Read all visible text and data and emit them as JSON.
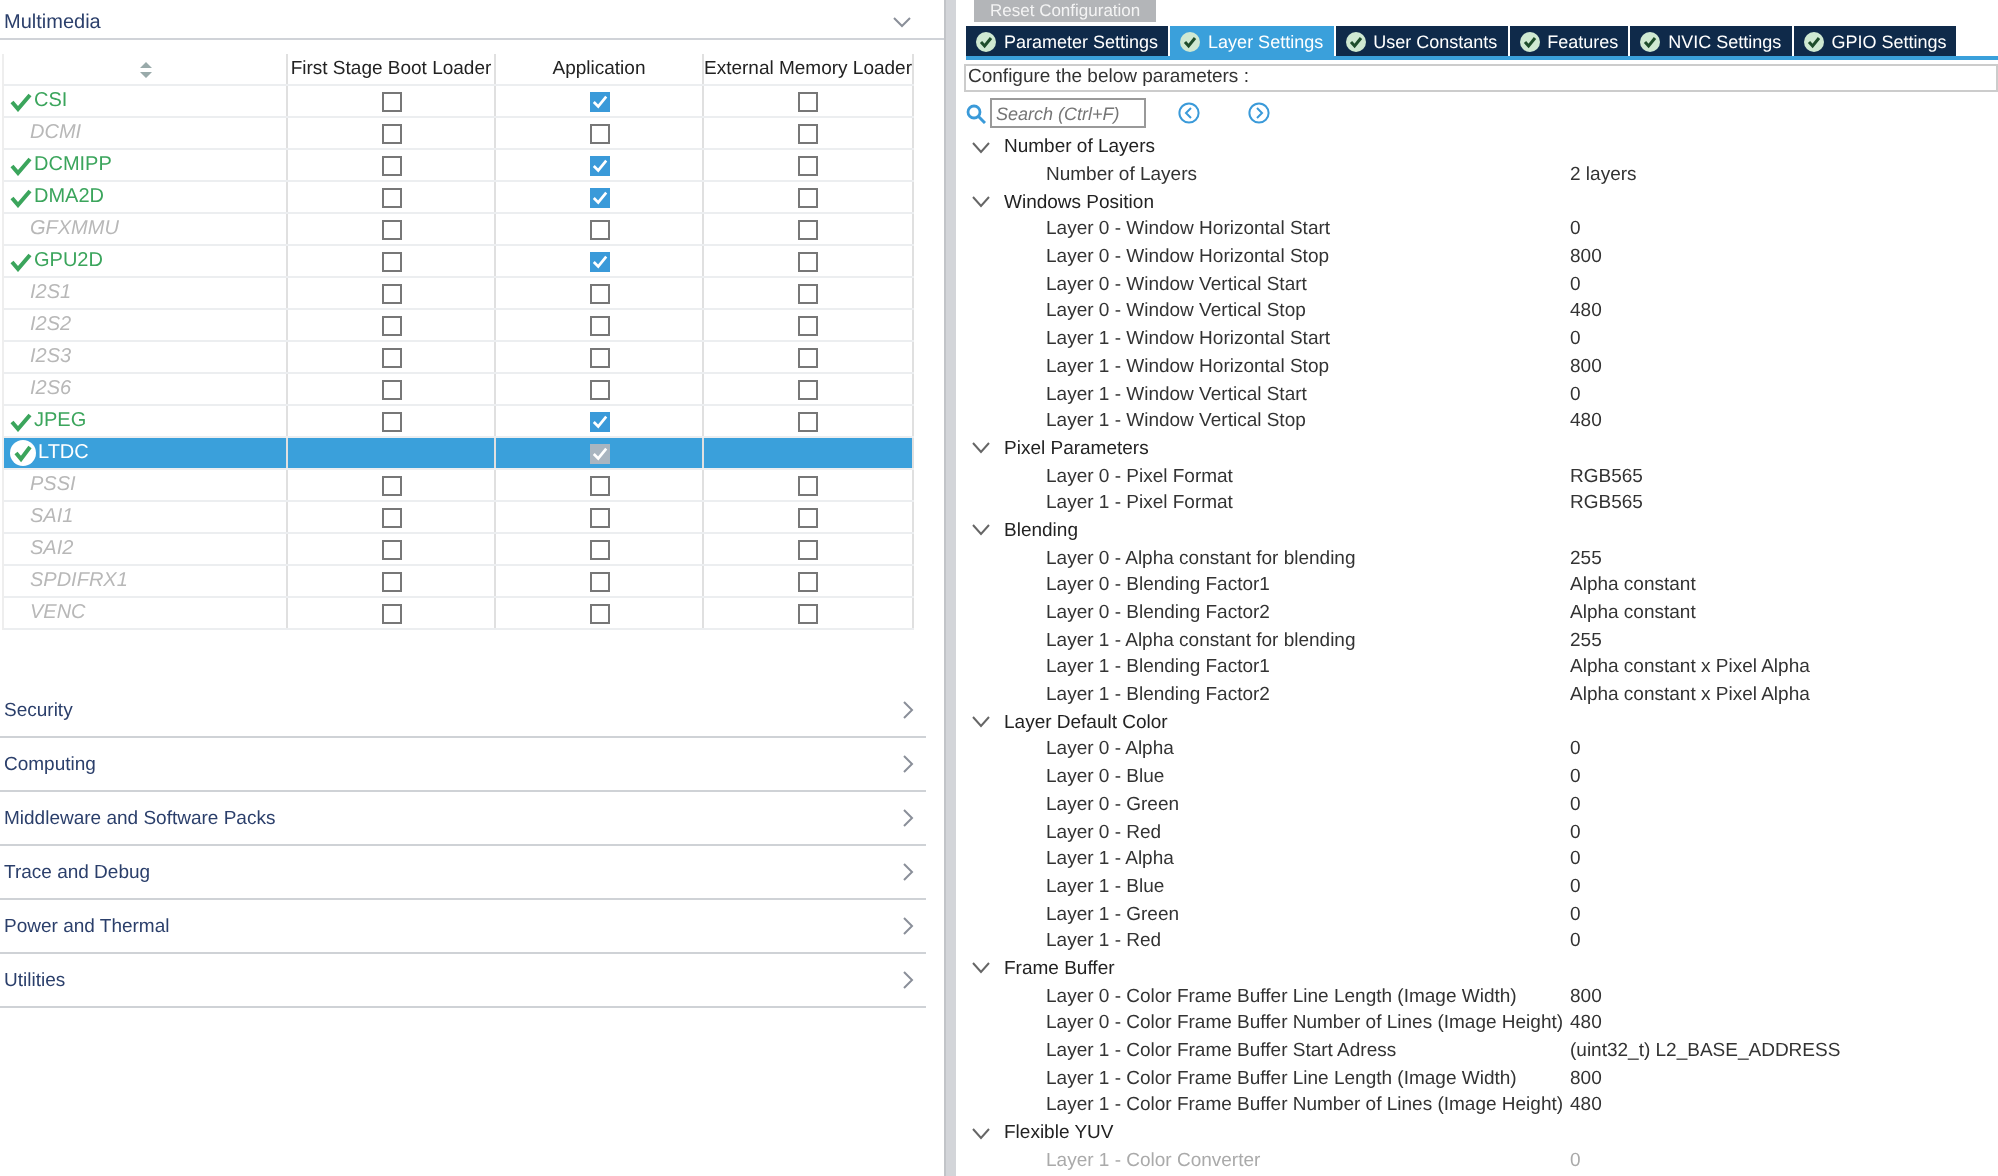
{
  "left_panel": {
    "section": {
      "title": "Multimedia",
      "expanded": true
    },
    "table": {
      "columns": [
        "First Stage Boot Loader",
        "Application",
        "External Memory Loader"
      ],
      "rows": [
        {
          "name": "CSI",
          "enabled": true,
          "selected": false,
          "cells": [
            {
              "checked": false
            },
            {
              "checked": true
            },
            {
              "checked": false
            }
          ]
        },
        {
          "name": "DCMI",
          "enabled": false,
          "selected": false,
          "cells": [
            {
              "checked": false
            },
            {
              "checked": false
            },
            {
              "checked": false
            }
          ]
        },
        {
          "name": "DCMIPP",
          "enabled": true,
          "selected": false,
          "cells": [
            {
              "checked": false
            },
            {
              "checked": true
            },
            {
              "checked": false
            }
          ]
        },
        {
          "name": "DMA2D",
          "enabled": true,
          "selected": false,
          "cells": [
            {
              "checked": false
            },
            {
              "checked": true
            },
            {
              "checked": false
            }
          ]
        },
        {
          "name": "GFXMMU",
          "enabled": false,
          "selected": false,
          "cells": [
            {
              "checked": false
            },
            {
              "checked": false
            },
            {
              "checked": false
            }
          ]
        },
        {
          "name": "GPU2D",
          "enabled": true,
          "selected": false,
          "cells": [
            {
              "checked": false
            },
            {
              "checked": true
            },
            {
              "checked": false
            }
          ]
        },
        {
          "name": "I2S1",
          "enabled": false,
          "selected": false,
          "cells": [
            {
              "checked": false
            },
            {
              "checked": false
            },
            {
              "checked": false
            }
          ]
        },
        {
          "name": "I2S2",
          "enabled": false,
          "selected": false,
          "cells": [
            {
              "checked": false
            },
            {
              "checked": false
            },
            {
              "checked": false
            }
          ]
        },
        {
          "name": "I2S3",
          "enabled": false,
          "selected": false,
          "cells": [
            {
              "checked": false
            },
            {
              "checked": false
            },
            {
              "checked": false
            }
          ]
        },
        {
          "name": "I2S6",
          "enabled": false,
          "selected": false,
          "cells": [
            {
              "checked": false
            },
            {
              "checked": false
            },
            {
              "checked": false
            }
          ]
        },
        {
          "name": "JPEG",
          "enabled": true,
          "selected": false,
          "cells": [
            {
              "checked": false
            },
            {
              "checked": true
            },
            {
              "checked": false
            }
          ]
        },
        {
          "name": "LTDC",
          "enabled": true,
          "selected": true,
          "cells": [
            null,
            {
              "checked": true
            },
            null
          ]
        },
        {
          "name": "PSSI",
          "enabled": false,
          "selected": false,
          "cells": [
            {
              "checked": false
            },
            {
              "checked": false
            },
            {
              "checked": false
            }
          ]
        },
        {
          "name": "SAI1",
          "enabled": false,
          "selected": false,
          "cells": [
            {
              "checked": false
            },
            {
              "checked": false
            },
            {
              "checked": false
            }
          ]
        },
        {
          "name": "SAI2",
          "enabled": false,
          "selected": false,
          "cells": [
            {
              "checked": false
            },
            {
              "checked": false
            },
            {
              "checked": false
            }
          ]
        },
        {
          "name": "SPDIFRX1",
          "enabled": false,
          "selected": false,
          "cells": [
            {
              "checked": false
            },
            {
              "checked": false
            },
            {
              "checked": false
            }
          ]
        },
        {
          "name": "VENC",
          "enabled": false,
          "selected": false,
          "cells": [
            {
              "checked": false
            },
            {
              "checked": false
            },
            {
              "checked": false
            }
          ]
        }
      ]
    },
    "categories": [
      {
        "label": "Security",
        "expanded": false
      },
      {
        "label": "Computing",
        "expanded": false
      },
      {
        "label": "Middleware and Software Packs",
        "expanded": false
      },
      {
        "label": "Trace and Debug",
        "expanded": false
      },
      {
        "label": "Power and Thermal",
        "expanded": false
      },
      {
        "label": "Utilities",
        "expanded": false
      }
    ]
  },
  "right_panel": {
    "reset_button": "Reset Configuration",
    "tabs": [
      {
        "label": "Parameter Settings",
        "selected": false
      },
      {
        "label": "Layer Settings",
        "selected": true
      },
      {
        "label": "User Constants",
        "selected": false
      },
      {
        "label": "Features",
        "selected": false
      },
      {
        "label": "NVIC Settings",
        "selected": false
      },
      {
        "label": "GPIO Settings",
        "selected": false
      }
    ],
    "instruction": "Configure the below parameters :",
    "search": {
      "placeholder": "Search (Ctrl+F)"
    },
    "groups": [
      {
        "label": "Number of Layers",
        "expanded": true,
        "children": [
          {
            "label": "Number of Layers",
            "value": "2 layers",
            "disabled": false
          }
        ]
      },
      {
        "label": "Windows Position",
        "expanded": true,
        "children": [
          {
            "label": "Layer 0 - Window Horizontal Start",
            "value": "0",
            "disabled": false
          },
          {
            "label": "Layer 0 - Window Horizontal Stop",
            "value": "800",
            "disabled": false
          },
          {
            "label": "Layer 0 - Window Vertical Start",
            "value": "0",
            "disabled": false
          },
          {
            "label": "Layer 0 - Window Vertical Stop",
            "value": "480",
            "disabled": false
          },
          {
            "label": "Layer 1 - Window Horizontal Start",
            "value": "0",
            "disabled": false
          },
          {
            "label": "Layer 1 - Window Horizontal Stop",
            "value": "800",
            "disabled": false
          },
          {
            "label": "Layer 1 - Window Vertical Start",
            "value": "0",
            "disabled": false
          },
          {
            "label": "Layer 1 - Window Vertical Stop",
            "value": "480",
            "disabled": false
          }
        ]
      },
      {
        "label": "Pixel Parameters",
        "expanded": true,
        "children": [
          {
            "label": "Layer 0 - Pixel Format",
            "value": "RGB565",
            "disabled": false
          },
          {
            "label": "Layer 1 - Pixel Format",
            "value": "RGB565",
            "disabled": false
          }
        ]
      },
      {
        "label": "Blending",
        "expanded": true,
        "children": [
          {
            "label": "Layer 0 - Alpha constant for blending",
            "value": "255",
            "disabled": false
          },
          {
            "label": "Layer 0 - Blending Factor1",
            "value": "Alpha constant",
            "disabled": false
          },
          {
            "label": "Layer 0 - Blending Factor2",
            "value": "Alpha constant",
            "disabled": false
          },
          {
            "label": "Layer 1 - Alpha constant for blending",
            "value": "255",
            "disabled": false
          },
          {
            "label": "Layer 1 - Blending Factor1",
            "value": "Alpha constant x Pixel Alpha",
            "disabled": false
          },
          {
            "label": "Layer 1 - Blending Factor2",
            "value": "Alpha constant x Pixel Alpha",
            "disabled": false
          }
        ]
      },
      {
        "label": "Layer Default Color",
        "expanded": true,
        "children": [
          {
            "label": "Layer 0 - Alpha",
            "value": "0",
            "disabled": false
          },
          {
            "label": "Layer 0 - Blue",
            "value": "0",
            "disabled": false
          },
          {
            "label": "Layer 0 - Green",
            "value": "0",
            "disabled": false
          },
          {
            "label": "Layer 0 - Red",
            "value": "0",
            "disabled": false
          },
          {
            "label": "Layer 1 - Alpha",
            "value": "0",
            "disabled": false
          },
          {
            "label": "Layer 1 - Blue",
            "value": "0",
            "disabled": false
          },
          {
            "label": "Layer 1 - Green",
            "value": "0",
            "disabled": false
          },
          {
            "label": "Layer 1 - Red",
            "value": "0",
            "disabled": false
          }
        ]
      },
      {
        "label": "Frame Buffer",
        "expanded": true,
        "children": [
          {
            "label": "Layer 0 - Color Frame Buffer Line Length (Image Width)",
            "value": "800",
            "disabled": false
          },
          {
            "label": "Layer 0 - Color Frame Buffer Number of Lines (Image Height)",
            "value": "480",
            "disabled": false
          },
          {
            "label": "Layer 1 - Color Frame Buffer Start Adress",
            "value": "(uint32_t) L2_BASE_ADDRESS",
            "disabled": false
          },
          {
            "label": "Layer 1 - Color Frame Buffer Line Length (Image Width)",
            "value": "800",
            "disabled": false
          },
          {
            "label": "Layer 1 - Color Frame Buffer Number of Lines (Image Height)",
            "value": "480",
            "disabled": false
          }
        ]
      },
      {
        "label": "Flexible YUV",
        "expanded": true,
        "children": [
          {
            "label": "Layer 1 - Color Converter",
            "value": "0",
            "disabled": true
          }
        ]
      }
    ]
  }
}
